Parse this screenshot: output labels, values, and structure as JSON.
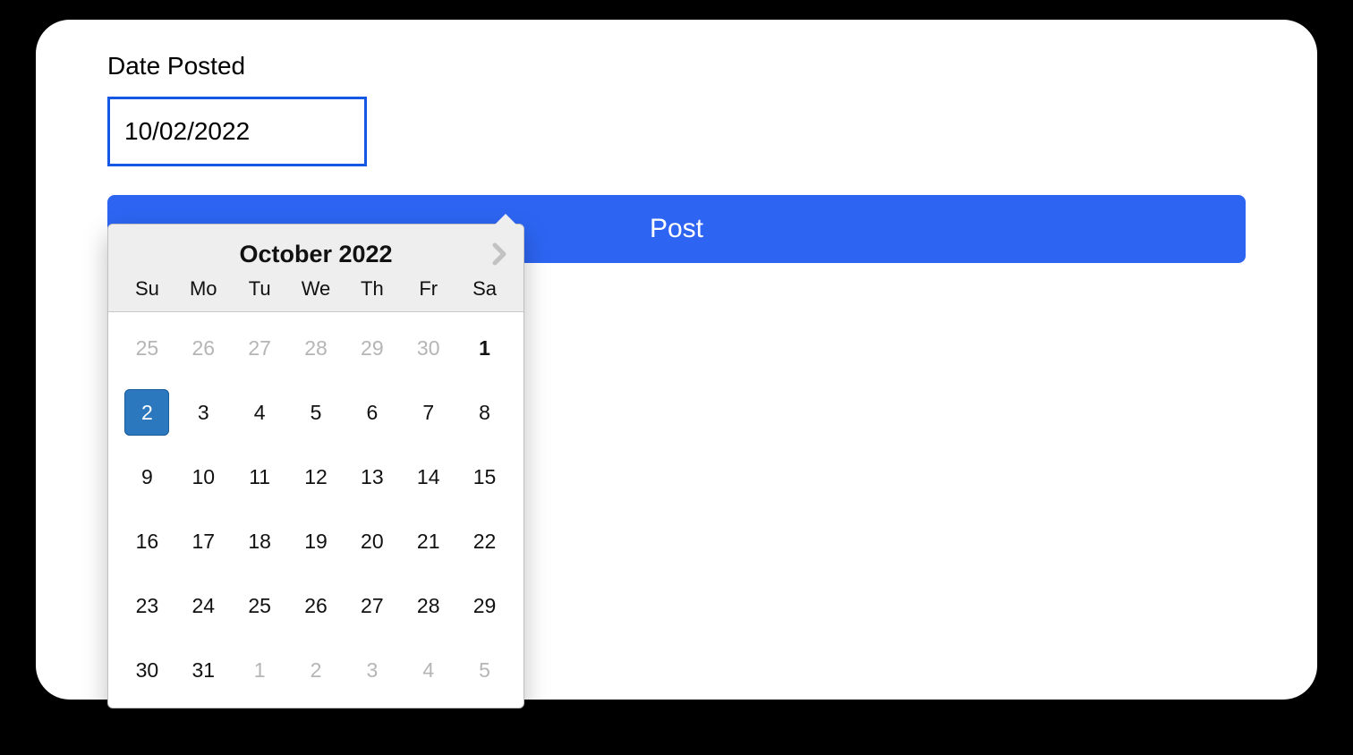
{
  "form": {
    "label": "Date Posted",
    "date_value": "10/02/2022",
    "post_label": "Post"
  },
  "datepicker": {
    "title": "October 2022",
    "dow": [
      "Su",
      "Mo",
      "Tu",
      "We",
      "Th",
      "Fr",
      "Sa"
    ],
    "weeks": [
      [
        {
          "d": "25",
          "out": true
        },
        {
          "d": "26",
          "out": true
        },
        {
          "d": "27",
          "out": true
        },
        {
          "d": "28",
          "out": true
        },
        {
          "d": "29",
          "out": true
        },
        {
          "d": "30",
          "out": true
        },
        {
          "d": "1",
          "today": true
        }
      ],
      [
        {
          "d": "2",
          "selected": true
        },
        {
          "d": "3"
        },
        {
          "d": "4"
        },
        {
          "d": "5"
        },
        {
          "d": "6"
        },
        {
          "d": "7"
        },
        {
          "d": "8"
        }
      ],
      [
        {
          "d": "9"
        },
        {
          "d": "10"
        },
        {
          "d": "11"
        },
        {
          "d": "12"
        },
        {
          "d": "13"
        },
        {
          "d": "14"
        },
        {
          "d": "15"
        }
      ],
      [
        {
          "d": "16"
        },
        {
          "d": "17"
        },
        {
          "d": "18"
        },
        {
          "d": "19"
        },
        {
          "d": "20"
        },
        {
          "d": "21"
        },
        {
          "d": "22"
        }
      ],
      [
        {
          "d": "23"
        },
        {
          "d": "24"
        },
        {
          "d": "25"
        },
        {
          "d": "26"
        },
        {
          "d": "27"
        },
        {
          "d": "28"
        },
        {
          "d": "29"
        }
      ],
      [
        {
          "d": "30"
        },
        {
          "d": "31"
        },
        {
          "d": "1",
          "out": true
        },
        {
          "d": "2",
          "out": true
        },
        {
          "d": "3",
          "out": true
        },
        {
          "d": "4",
          "out": true
        },
        {
          "d": "5",
          "out": true
        }
      ]
    ]
  }
}
